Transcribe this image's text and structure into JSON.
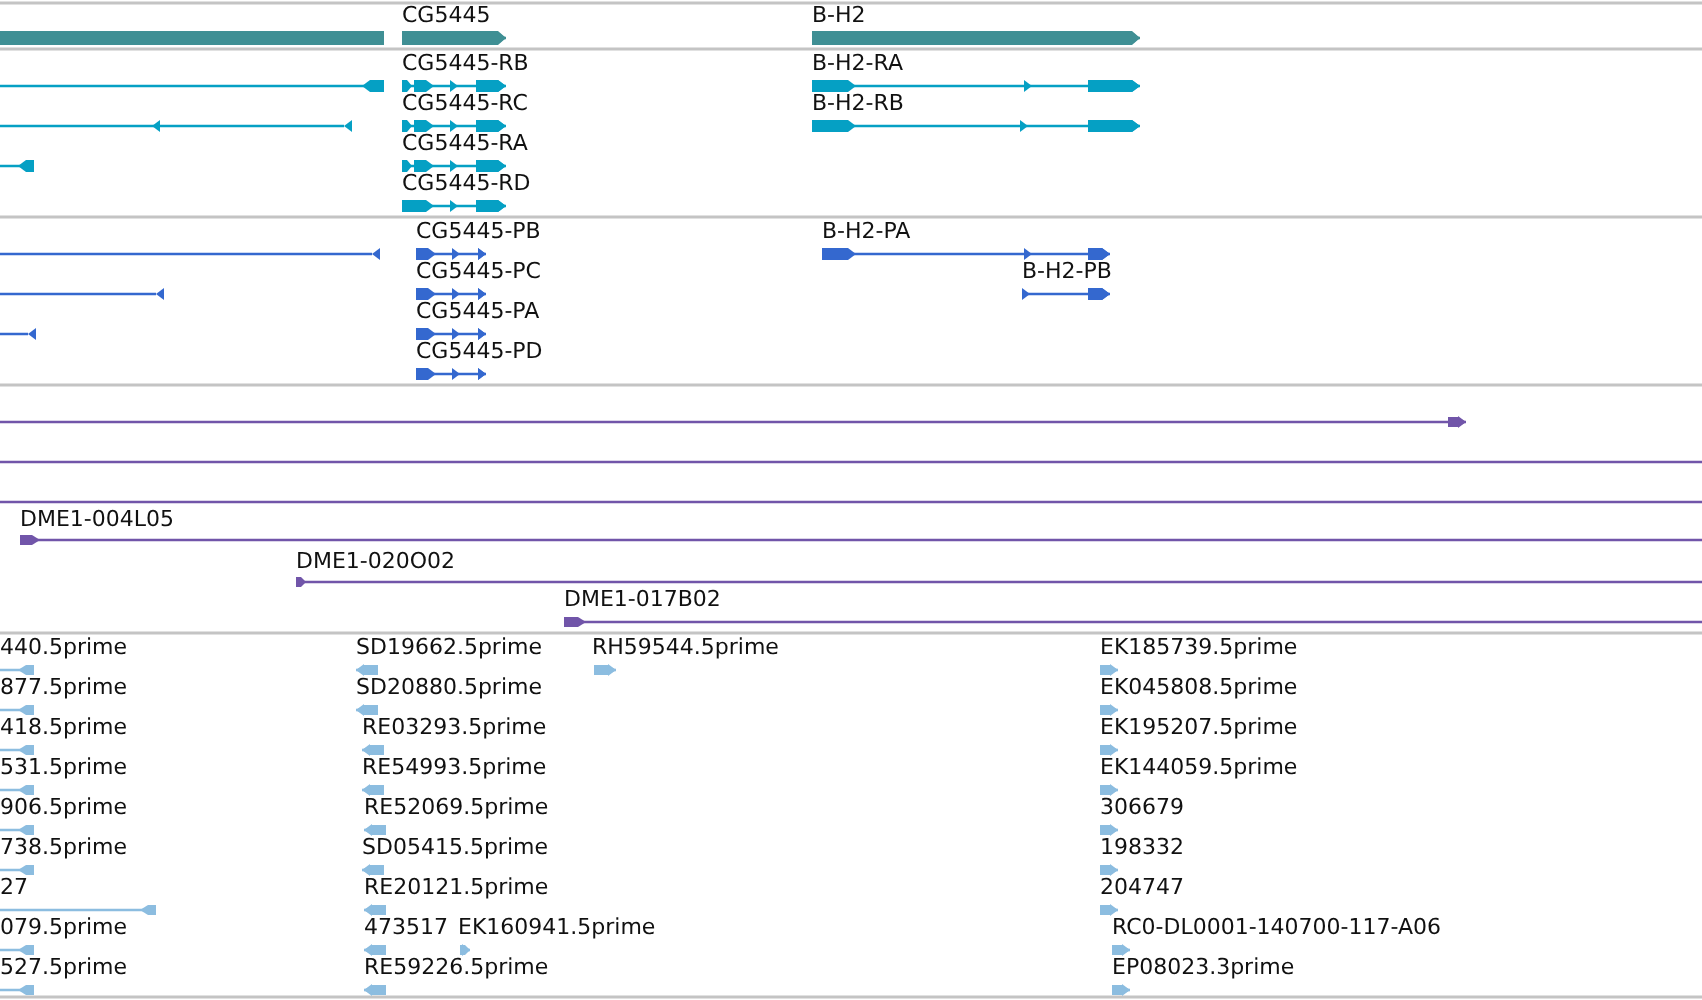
{
  "tracks": [
    {
      "kind": "gene",
      "features": [
        {
          "reverse": true
        },
        {
          "label": "CG5445",
          "reverse": false
        },
        {
          "label": "B-H2",
          "reverse": false
        }
      ]
    },
    {
      "kind": "transcript",
      "features": [
        {
          "reverse": true
        },
        {
          "reverse": true
        },
        {
          "reverse": true
        },
        {
          "label": "CG5445-RB",
          "reverse": false
        },
        {
          "label": "CG5445-RC",
          "reverse": false
        },
        {
          "label": "CG5445-RA",
          "reverse": false
        },
        {
          "label": "CG5445-RD",
          "reverse": false
        },
        {
          "label": "B-H2-RA",
          "reverse": false
        },
        {
          "label": "B-H2-RB",
          "reverse": false
        }
      ]
    },
    {
      "kind": "protein",
      "features": [
        {
          "reverse": true
        },
        {
          "reverse": true
        },
        {
          "reverse": true
        },
        {
          "label": "CG5445-PB",
          "reverse": false
        },
        {
          "label": "CG5445-PC",
          "reverse": false
        },
        {
          "label": "CG5445-PA",
          "reverse": false
        },
        {
          "label": "CG5445-PD",
          "reverse": false
        },
        {
          "label": "B-H2-PA",
          "reverse": false
        },
        {
          "label": "B-H2-PB",
          "reverse": false
        }
      ]
    },
    {
      "kind": "clone",
      "features": [
        {
          "reverse": false
        },
        {
          "label": "DME1-004L05",
          "reverse": false
        },
        {
          "label": "DME1-020O02",
          "reverse": false
        },
        {
          "label": "DME1-017B02",
          "reverse": false
        }
      ]
    },
    {
      "kind": "est",
      "features": [
        {
          "label": "440.5prime",
          "reverse": true
        },
        {
          "label": "SD19662.5prime",
          "reverse": true
        },
        {
          "label": "RH59544.5prime",
          "reverse": false
        },
        {
          "label": "EK185739.5prime",
          "reverse": false
        },
        {
          "label": "877.5prime",
          "reverse": true
        },
        {
          "label": "SD20880.5prime",
          "reverse": true
        },
        {
          "label": "EK045808.5prime",
          "reverse": false
        },
        {
          "label": "418.5prime",
          "reverse": true
        },
        {
          "label": "RE03293.5prime",
          "reverse": true
        },
        {
          "label": "EK195207.5prime",
          "reverse": false
        },
        {
          "label": "531.5prime",
          "reverse": true
        },
        {
          "label": "RE54993.5prime",
          "reverse": true
        },
        {
          "label": "EK144059.5prime",
          "reverse": false
        },
        {
          "label": "906.5prime",
          "reverse": true
        },
        {
          "label": "RE52069.5prime",
          "reverse": true
        },
        {
          "label": "306679",
          "reverse": false
        },
        {
          "label": "738.5prime",
          "reverse": true
        },
        {
          "label": "SD05415.5prime",
          "reverse": true
        },
        {
          "label": "198332",
          "reverse": false
        },
        {
          "label": "27",
          "reverse": true
        },
        {
          "label": "RE20121.5prime",
          "reverse": true
        },
        {
          "label": "204747",
          "reverse": false
        },
        {
          "label": "079.5prime",
          "reverse": true
        },
        {
          "label": "473517",
          "reverse": true
        },
        {
          "label": "EK160941.5prime",
          "reverse": false
        },
        {
          "label": "RC0-DL0001-140700-117-A06",
          "reverse": false
        },
        {
          "label": "527.5prime",
          "reverse": true
        },
        {
          "label": "RE59226.5prime",
          "reverse": true
        },
        {
          "label": "EP08023.3prime",
          "reverse": false
        }
      ]
    }
  ]
}
